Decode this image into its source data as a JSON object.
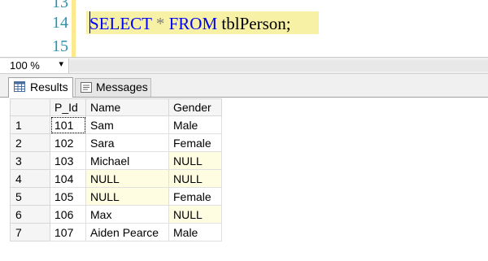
{
  "editor": {
    "line_numbers": [
      "13",
      "14",
      "15"
    ],
    "code_tokens": {
      "select": "SELECT",
      "star": "*",
      "from": "FROM",
      "table": "tblPerson;"
    }
  },
  "zoom": {
    "value": "100 %",
    "arrow": "▾"
  },
  "tabs": {
    "results": "Results",
    "messages": "Messages"
  },
  "results_grid": {
    "columns": [
      "P_Id",
      "Name",
      "Gender"
    ],
    "rows": [
      {
        "num": "1",
        "pid": "101",
        "name": "Sam",
        "gender": "Male"
      },
      {
        "num": "2",
        "pid": "102",
        "name": "Sara",
        "gender": "Female"
      },
      {
        "num": "3",
        "pid": "103",
        "name": "Michael",
        "gender": "NULL"
      },
      {
        "num": "4",
        "pid": "104",
        "name": "NULL",
        "gender": "NULL"
      },
      {
        "num": "5",
        "pid": "105",
        "name": "NULL",
        "gender": "Female"
      },
      {
        "num": "6",
        "pid": "106",
        "name": "Max",
        "gender": "NULL"
      },
      {
        "num": "7",
        "pid": "107",
        "name": "Aiden Pearce",
        "gender": "Male"
      }
    ]
  },
  "colors": {
    "keyword": "#0000ff",
    "line_number": "#2b91af",
    "highlight": "#f7f1a6",
    "null_cell": "#fffde1"
  }
}
